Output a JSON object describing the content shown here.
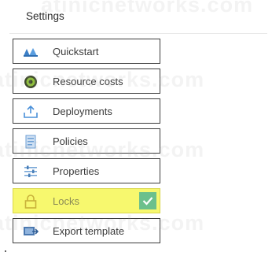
{
  "panel": {
    "title": "Settings"
  },
  "watermark": "atinicnetworks.com",
  "menu": {
    "items": [
      {
        "label": "Quickstart",
        "icon": "quickstart-icon"
      },
      {
        "label": "Resource costs",
        "icon": "resource-costs-icon"
      },
      {
        "label": "Deployments",
        "icon": "deployments-icon"
      },
      {
        "label": "Policies",
        "icon": "policies-icon"
      },
      {
        "label": "Properties",
        "icon": "properties-icon"
      },
      {
        "label": "Locks",
        "icon": "lock-icon",
        "selected": true,
        "checked": true
      },
      {
        "label": "Export template",
        "icon": "export-template-icon"
      }
    ]
  },
  "colors": {
    "highlight": "#f7f86e",
    "check": "#6cc08c",
    "border": "#3c3c3c",
    "icon_blue": "#4a90d9"
  }
}
